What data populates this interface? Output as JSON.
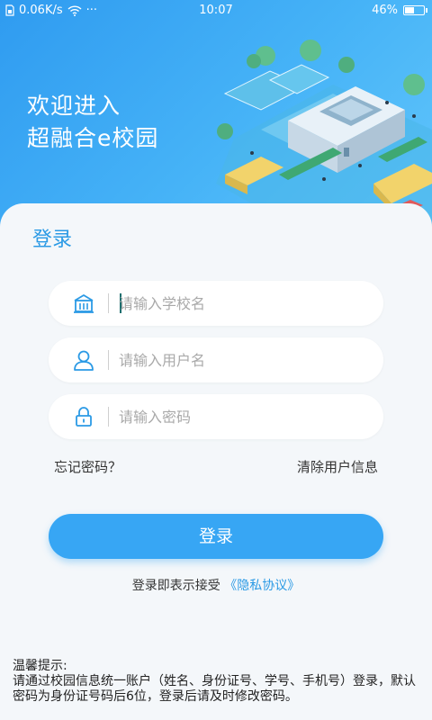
{
  "status_bar": {
    "speed": "0.06K/s",
    "dots": "···",
    "time": "10:07",
    "battery_percent": "46%",
    "battery_level": 0.46
  },
  "header": {
    "welcome_line1": "欢迎进入",
    "welcome_line2": "超融合e校园"
  },
  "login": {
    "title": "登录",
    "school_placeholder": "请输入学校名",
    "username_placeholder": "请输入用户名",
    "password_placeholder": "请输入密码",
    "forgot_password": "忘记密码？",
    "clear_user_info": "清除用户信息",
    "login_button": "登录",
    "agreement_prefix": "登录即表示接受",
    "privacy_link": "《隐私协议》"
  },
  "tips": {
    "title": "温馨提示:",
    "body": "请通过校园信息统一账户（姓名、身份证号、学号、手机号）登录，默认密码为身份证号码后6位，登录后请及时修改密码。"
  },
  "colors": {
    "accent": "#37a6f4",
    "title_blue": "#2b9ae5",
    "header_gradient_start": "#2f9bf0",
    "header_gradient_end": "#62c6fb"
  }
}
